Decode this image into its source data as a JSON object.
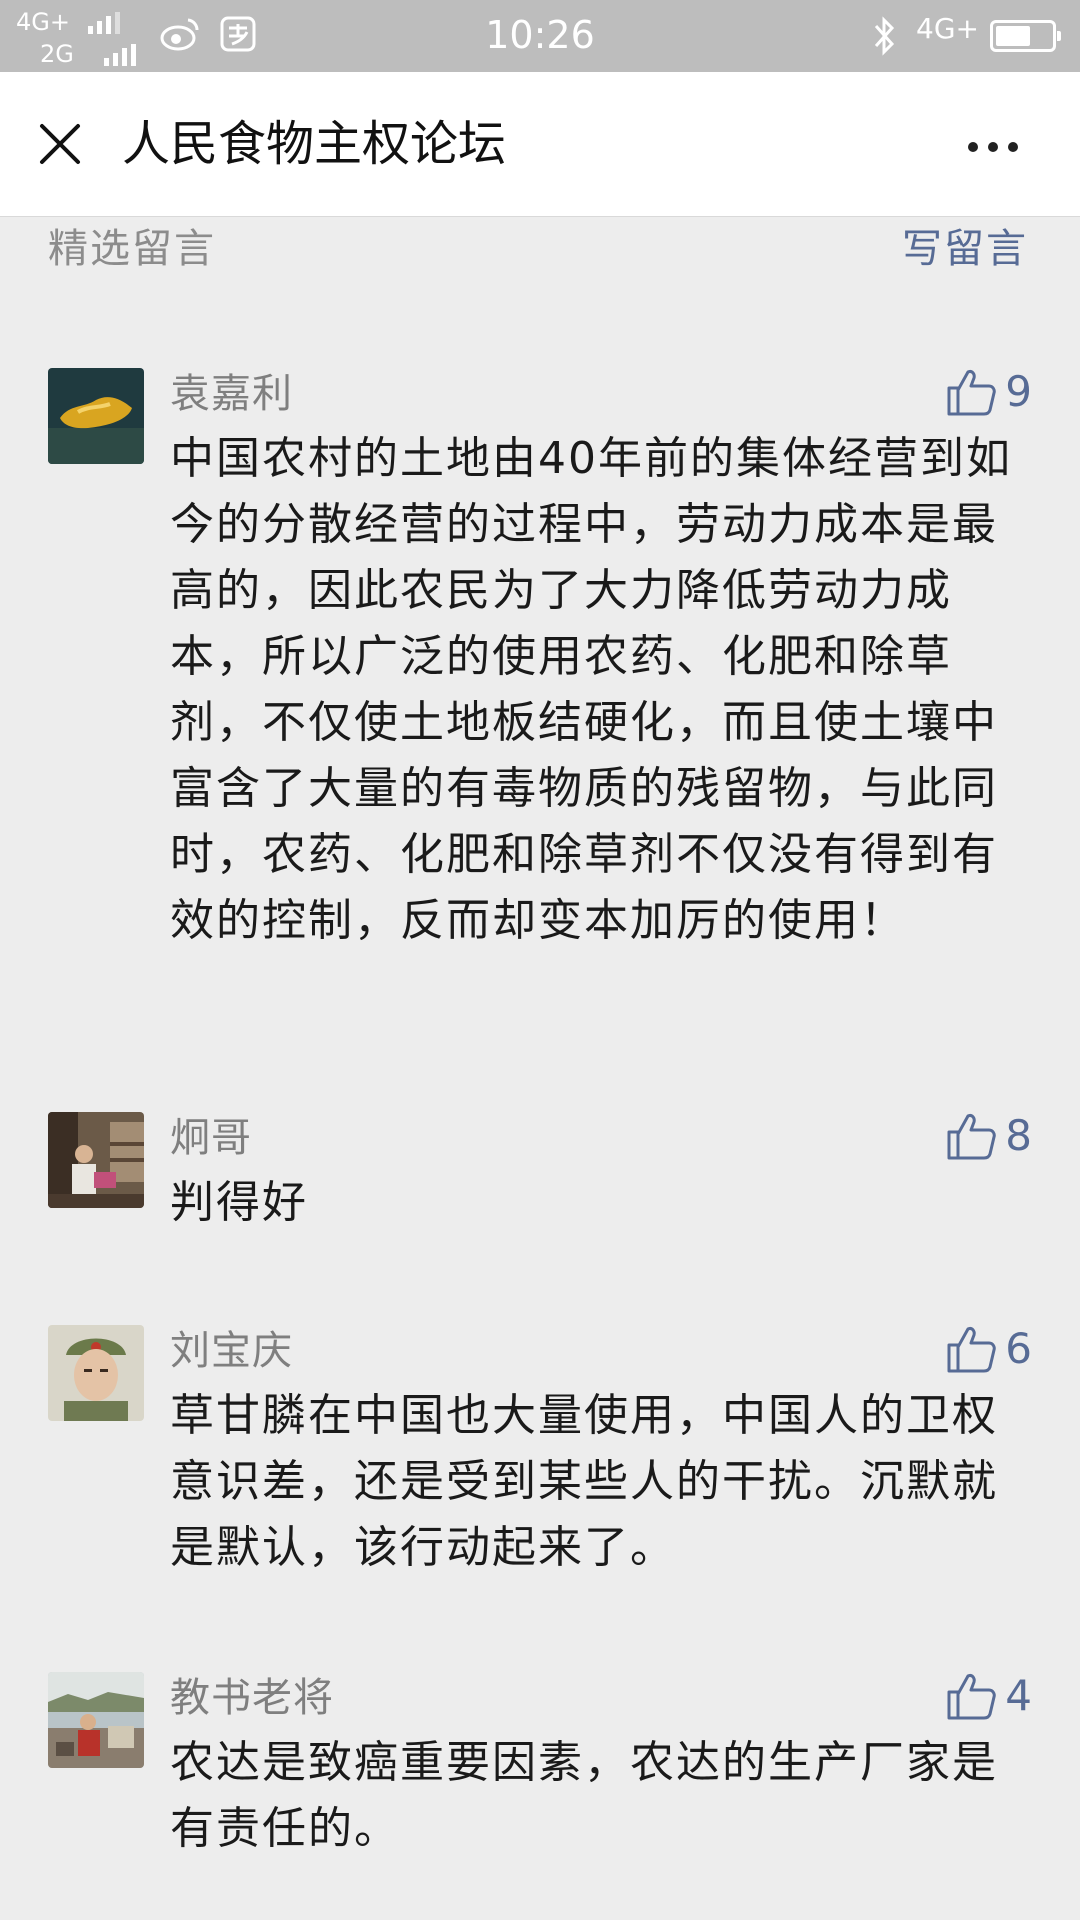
{
  "status_bar": {
    "network_top": "4G+",
    "network_bottom": "2G",
    "time": "10:26",
    "network_right": "4G+",
    "icons": [
      "weibo-icon",
      "alipay-icon",
      "bluetooth-icon",
      "battery-icon"
    ]
  },
  "nav": {
    "title": "人民食物主权论坛",
    "close_icon": "close-icon",
    "more_icon": "more-icon"
  },
  "section": {
    "title": "精选留言",
    "write_label": "写留言"
  },
  "colors": {
    "link": "#576b95",
    "background": "#ededed"
  },
  "comments": [
    {
      "name": "袁嘉利",
      "likes": "9",
      "text": "中国农村的土地由40年前的集体经营到如今的分散经营的过程中，劳动力成本是最高的，因此农民为了大力降低劳动力成本，所以广泛的使用农药、化肥和除草剂，不仅使土地板结硬化，而且使土壤中富含了大量的有毒物质的残留物，与此同时，农药、化肥和除草剂不仅没有得到有效的控制，反而却变本加厉的使用！"
    },
    {
      "name": "炯哥",
      "likes": "8",
      "text": "判得好"
    },
    {
      "name": "刘宝庆",
      "likes": "6",
      "text": "草甘膦在中国也大量使用，中国人的卫权意识差，还是受到某些人的干扰。沉默就是默认，该行动起来了。"
    },
    {
      "name": "教书老将",
      "likes": "4",
      "text": "农达是致癌重要因素，农达的生产厂家是有责任的。"
    }
  ]
}
